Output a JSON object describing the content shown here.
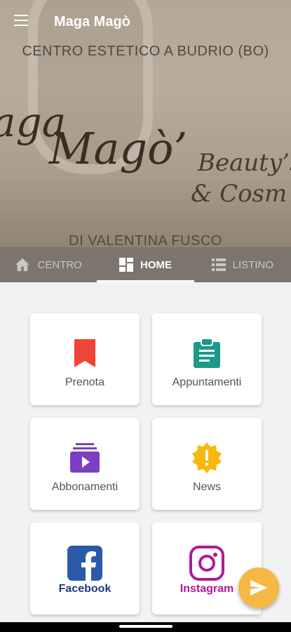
{
  "appbar": {
    "title": "Maga Magò",
    "menu_icon": "menu-icon"
  },
  "hero": {
    "line1": "CENTRO ESTETICO A BUDRIO (BO)",
    "logo_script_1": "aga",
    "logo_script_2": "Magò’",
    "logo_script_3": "Beauty’s",
    "logo_script_4": "& Cosm",
    "line2": "DI VALENTINA FUSCO"
  },
  "tabs": [
    {
      "label": "CENTRO",
      "icon": "home-icon",
      "active": false
    },
    {
      "label": "HOME",
      "icon": "dashboard-icon",
      "active": true
    },
    {
      "label": "LISTINO",
      "icon": "list-icon",
      "active": false
    }
  ],
  "cards": [
    {
      "label": "Prenota",
      "icon": "bookmark-icon",
      "color": "#f04438"
    },
    {
      "label": "Appuntamenti",
      "icon": "clipboard-icon",
      "color": "#1a9a8a"
    },
    {
      "label": "Abbonamenti",
      "icon": "subscriptions-icon",
      "color": "#7b3fc4"
    },
    {
      "label": "News",
      "icon": "alert-badge-icon",
      "color": "#f6b80e"
    },
    {
      "label": "Facebook",
      "icon": "facebook-icon",
      "color": "#2d5aa8"
    },
    {
      "label": "Instagram",
      "icon": "instagram-icon",
      "color": "#b0189a"
    }
  ],
  "fab": {
    "icon": "send-icon",
    "color": "#f6b844"
  }
}
